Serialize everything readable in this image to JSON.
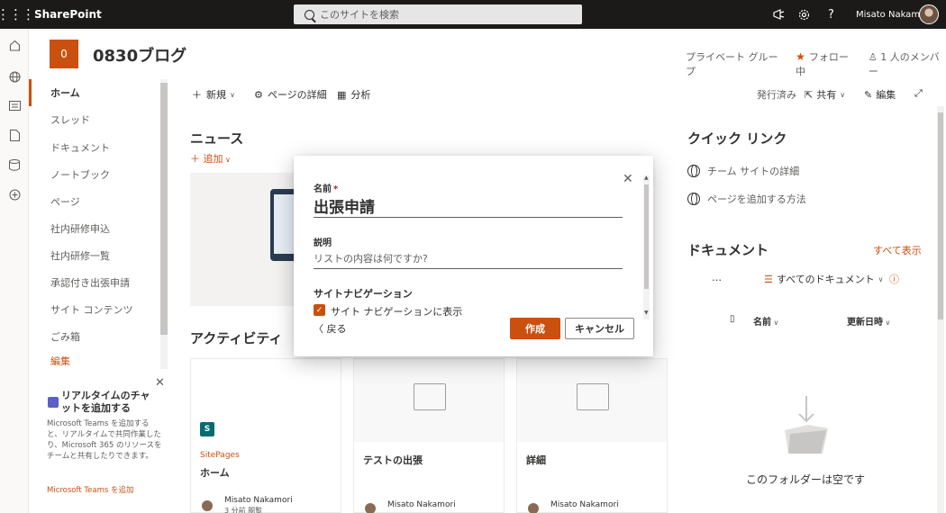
{
  "topbar": {
    "brand": "SharePoint",
    "search_placeholder": "このサイトを検索",
    "user_name": "Misato Nakamori",
    "help": "?"
  },
  "site": {
    "logo_text": "0",
    "title": "0830ブログ",
    "privacy": "プライベート グループ",
    "follow": "フォロー中",
    "members": "1 人のメンバー"
  },
  "nav": {
    "items": [
      {
        "label": "ホーム"
      },
      {
        "label": "スレッド"
      },
      {
        "label": "ドキュメント"
      },
      {
        "label": "ノートブック"
      },
      {
        "label": "ページ"
      },
      {
        "label": "社内研修申込"
      },
      {
        "label": "社内研修一覧"
      },
      {
        "label": "承認付き出張申請"
      },
      {
        "label": "サイト コンテンツ"
      },
      {
        "label": "ごみ箱"
      },
      {
        "label": "編集"
      }
    ]
  },
  "promo": {
    "title": "リアルタイムのチャットを追加する",
    "body": "Microsoft Teams を追加すると、リアルタイムで共同作業したり、Microsoft 365 のリソースをチームと共有したりできます。",
    "link": "Microsoft Teams を追加"
  },
  "commandbar": {
    "new": "新規",
    "page_details": "ページの詳細",
    "analytics": "分析",
    "published": "発行済み",
    "share": "共有",
    "edit": "編集"
  },
  "news": {
    "heading": "ニュース",
    "add": "追加"
  },
  "activity": {
    "heading": "アクティビティ",
    "cards": [
      {
        "sub": "SitePages",
        "title": "ホーム",
        "user": "Misato Nakamori",
        "meta": "3 分前 閲覧"
      },
      {
        "sub": "",
        "title": "テストの出張",
        "user": "Misato Nakamori",
        "meta": ""
      },
      {
        "sub": "",
        "title": "詳細",
        "user": "Misato Nakamori",
        "meta": ""
      }
    ]
  },
  "quicklinks": {
    "heading": "クイック リンク",
    "items": [
      {
        "label": "チーム サイトの詳細"
      },
      {
        "label": "ページを追加する方法"
      }
    ]
  },
  "documents": {
    "heading": "ドキュメント",
    "see_all": "すべて表示",
    "more": "…",
    "view": "すべてのドキュメント",
    "col_name": "名前",
    "col_modified": "更新日時",
    "empty": "このフォルダーは空です"
  },
  "dialog": {
    "name_label": "名前",
    "required_mark": "*",
    "name_value": "出張申請",
    "desc_label": "説明",
    "desc_placeholder": "リストの内容は何ですか?",
    "nav_label": "サイトナビゲーション",
    "nav_checkbox_label": "サイト ナビゲーションに表示",
    "nav_checked": true,
    "back": "戻る",
    "create": "作成",
    "cancel": "キャンセル"
  },
  "colors": {
    "accent": "#ca5010",
    "topbar": "#1b1a19",
    "required": "#a4262c"
  },
  "icons": [
    "waffle-icon",
    "search-icon",
    "megaphone-icon",
    "gear-icon",
    "help-icon",
    "home-icon",
    "globe-icon",
    "news-icon",
    "file-icon",
    "database-icon",
    "add-circle-icon",
    "star-icon",
    "person-icon",
    "plus-icon",
    "gear-icon",
    "chart-icon",
    "share-icon",
    "pencil-icon",
    "expand-icon",
    "folder-icon",
    "filter-icon",
    "info-icon",
    "close-icon",
    "checkmark-icon",
    "chevron-left-icon"
  ]
}
